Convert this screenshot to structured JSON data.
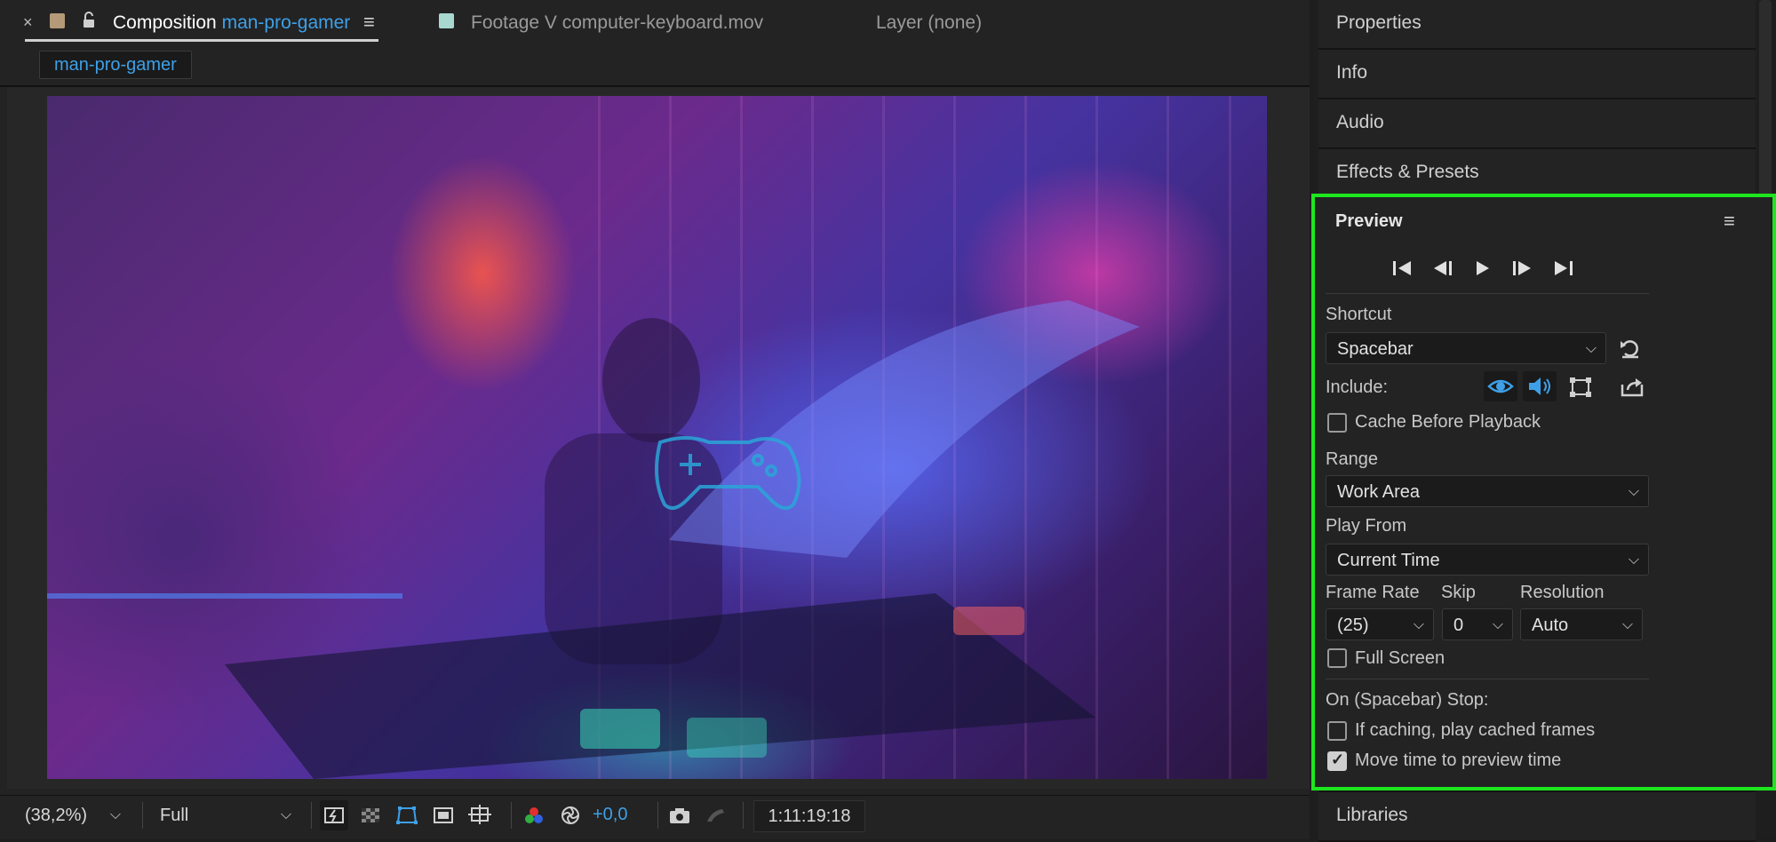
{
  "composition_tab": {
    "close": "×",
    "prefix": "Composition",
    "name": "man-pro-gamer",
    "menu": "≡"
  },
  "footage_tab": {
    "label": "Footage V computer-keyboard.mov"
  },
  "layer_tab": {
    "label": "Layer (none)"
  },
  "breadcrumb": "man-pro-gamer",
  "bottom_toolbar": {
    "zoom": "(38,2%)",
    "resolution": "Full",
    "exposure": "+0,0",
    "timecode": "1:11:19:18"
  },
  "right_panel": {
    "sections_top": [
      "Properties",
      "Info",
      "Audio",
      "Effects & Presets"
    ],
    "section_bottom": "Libraries"
  },
  "preview": {
    "title": "Preview",
    "menu": "≡",
    "shortcut_label": "Shortcut",
    "shortcut_value": "Spacebar",
    "include_label": "Include:",
    "cache_before_playback": {
      "label": "Cache Before Playback",
      "checked": false
    },
    "range_label": "Range",
    "range_value": "Work Area",
    "play_from_label": "Play From",
    "play_from_value": "Current Time",
    "frame_rate_label": "Frame Rate",
    "frame_rate_value": "(25)",
    "skip_label": "Skip",
    "skip_value": "0",
    "resolution_label": "Resolution",
    "resolution_value": "Auto",
    "full_screen": {
      "label": "Full Screen",
      "checked": false
    },
    "on_stop_label": "On (Spacebar) Stop:",
    "if_caching": {
      "label": "If caching, play cached frames",
      "checked": false
    },
    "move_time": {
      "label": "Move time to preview time",
      "checked": true
    }
  },
  "colors": {
    "accent_blue": "#3ea0e8",
    "highlight_green": "#1ee61e"
  }
}
